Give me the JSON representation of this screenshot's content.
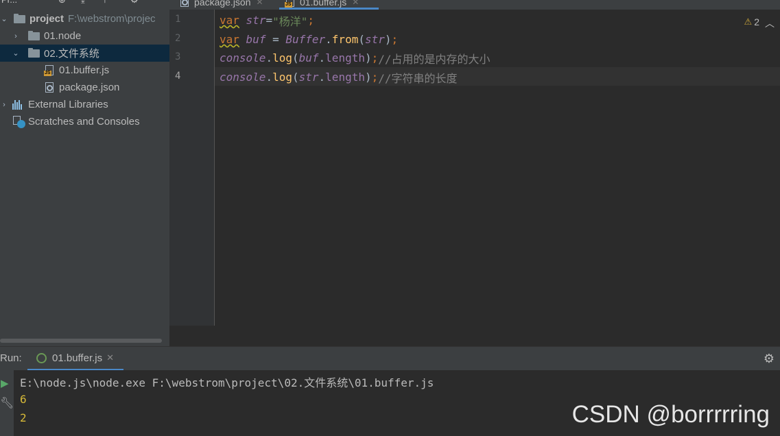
{
  "project_panel": {
    "toolbar_label": "Pr...",
    "tree": [
      {
        "label": "project",
        "hint": "F:\\webstrom\\projec"
      },
      {
        "label": "01.node"
      },
      {
        "label": "02.文件系统"
      },
      {
        "label": "01.buffer.js"
      },
      {
        "label": "package.json"
      },
      {
        "label": "External Libraries"
      },
      {
        "label": "Scratches and Consoles"
      }
    ]
  },
  "editor": {
    "tabs": [
      {
        "label": "package.json"
      },
      {
        "label": "01.buffer.js"
      }
    ],
    "warning_count": "2",
    "line_numbers": [
      "1",
      "2",
      "3",
      "4"
    ],
    "code": {
      "l1": {
        "kw": "var",
        "name": "str",
        "eq": "=",
        "str": "\"杨洋\"",
        "semi": ";"
      },
      "l2": {
        "kw": "var",
        "name": "buf",
        "eq": " = ",
        "cls": "Buffer",
        "dot": ".",
        "fn": "from",
        "open": "(",
        "arg": "str",
        "close": ")",
        "semi": ";"
      },
      "l3": {
        "obj": "console",
        "dot": ".",
        "fn": "log",
        "open": "(",
        "arg": "buf",
        "dot2": ".",
        "prop": "length",
        "close": ")",
        "semi": ";",
        "comment": "//占用的是内存的大小"
      },
      "l4": {
        "obj": "console",
        "dot": ".",
        "fn": "log",
        "open": "(",
        "arg": "str",
        "dot2": ".",
        "prop": "length",
        "close": ")",
        "semi": ";",
        "comment": "//字符串的长度"
      }
    }
  },
  "run": {
    "label": "Run:",
    "tab_label": "01.buffer.js",
    "output": [
      "E:\\node.js\\node.exe F:\\webstrom\\project\\02.文件系统\\01.buffer.js",
      "6",
      "2"
    ]
  },
  "watermark": "CSDN @borrrrring",
  "colors": {
    "keyword": "#cc7832",
    "variable": "#9876aa",
    "string": "#6a8759",
    "function": "#ffc66d",
    "comment": "#808080",
    "output_number": "#d7ba38",
    "selection": "#0d293e",
    "accent": "#4a88c7"
  }
}
